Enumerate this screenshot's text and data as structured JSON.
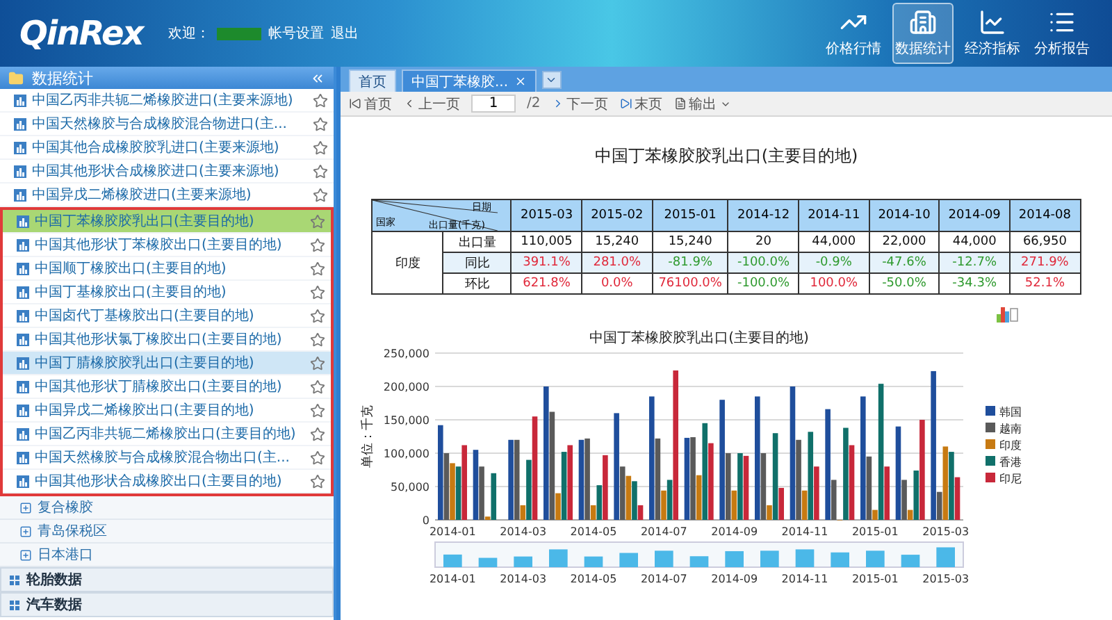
{
  "header": {
    "logo": "QinRex",
    "welcome": "欢迎：",
    "account_link": "帐号设置",
    "logout": "退出",
    "nav": [
      {
        "label": "价格行情",
        "selected": false,
        "kind": "trend"
      },
      {
        "label": "数据统计",
        "selected": true,
        "kind": "building"
      },
      {
        "label": "经济指标",
        "selected": false,
        "kind": "indicator"
      },
      {
        "label": "分析报告",
        "selected": false,
        "kind": "list"
      }
    ]
  },
  "sidebar": {
    "title": "数据统计",
    "groups": [
      {
        "outlined": false,
        "items": [
          {
            "label": "中国乙丙非共轭二烯橡胶进口(主要来源地)",
            "selected": false,
            "highlighted": false
          },
          {
            "label": "中国天然橡胶与合成橡胶混合物进口(主...",
            "selected": false,
            "highlighted": false
          },
          {
            "label": "中国其他合成橡胶胶乳进口(主要来源地)",
            "selected": false,
            "highlighted": false
          },
          {
            "label": "中国其他形状合成橡胶进口(主要来源地)",
            "selected": false,
            "highlighted": false
          },
          {
            "label": "中国异戊二烯橡胶进口(主要来源地)",
            "selected": false,
            "highlighted": false
          }
        ]
      },
      {
        "outlined": true,
        "items": [
          {
            "label": "中国丁苯橡胶胶乳出口(主要目的地)",
            "selected": true,
            "highlighted": false
          },
          {
            "label": "中国其他形状丁苯橡胶出口(主要目的地)",
            "selected": false,
            "highlighted": false
          },
          {
            "label": "中国顺丁橡胶出口(主要目的地)",
            "selected": false,
            "highlighted": false
          },
          {
            "label": "中国丁基橡胶出口(主要目的地)",
            "selected": false,
            "highlighted": false
          },
          {
            "label": "中国卤代丁基橡胶出口(主要目的地)",
            "selected": false,
            "highlighted": false
          },
          {
            "label": "中国其他形状氯丁橡胶出口(主要目的地)",
            "selected": false,
            "highlighted": false
          },
          {
            "label": "中国丁腈橡胶胶乳出口(主要目的地)",
            "selected": false,
            "highlighted": true
          },
          {
            "label": "中国其他形状丁腈橡胶出口(主要目的地)",
            "selected": false,
            "highlighted": false
          },
          {
            "label": "中国异戊二烯橡胶出口(主要目的地)",
            "selected": false,
            "highlighted": false
          },
          {
            "label": "中国乙丙非共轭二烯橡胶出口(主要目的地)",
            "selected": false,
            "highlighted": false
          },
          {
            "label": "中国天然橡胶与合成橡胶混合物出口(主...",
            "selected": false,
            "highlighted": false
          },
          {
            "label": "中国其他形状合成橡胶出口(主要目的地)",
            "selected": false,
            "highlighted": false
          }
        ]
      }
    ],
    "subgroups": [
      {
        "label": "复合橡胶",
        "expanded": false
      },
      {
        "label": "青岛保税区",
        "expanded": false
      },
      {
        "label": "日本港口",
        "expanded": false
      }
    ],
    "sections": [
      "轮胎数据",
      "汽车数据"
    ]
  },
  "tabs": [
    {
      "label": "首页",
      "selected": false,
      "closable": false
    },
    {
      "label": "中国丁苯橡胶...",
      "selected": true,
      "closable": true
    }
  ],
  "toolbar": {
    "first": "首页",
    "prev": "上一页",
    "page": "1",
    "total": "/2",
    "next": "下一页",
    "last": "末页",
    "export": "输出"
  },
  "report": {
    "title": "中国丁苯橡胶胶乳出口(主要目的地)",
    "table": {
      "corner": {
        "top": "日期",
        "middle": "出口量(千克)",
        "bottom": "国家"
      },
      "columns": [
        "2015-03",
        "2015-02",
        "2015-01",
        "2014-12",
        "2014-11",
        "2014-10",
        "2014-09",
        "2014-08"
      ],
      "country": "印度",
      "rows": [
        {
          "label": "出口量",
          "cells": [
            {
              "text": "110,005",
              "kind": "plain"
            },
            {
              "text": "15,240",
              "kind": "plain"
            },
            {
              "text": "15,240",
              "kind": "plain"
            },
            {
              "text": "20",
              "kind": "plain"
            },
            {
              "text": "44,000",
              "kind": "plain"
            },
            {
              "text": "22,000",
              "kind": "plain"
            },
            {
              "text": "44,000",
              "kind": "plain"
            },
            {
              "text": "66,950",
              "kind": "plain"
            }
          ]
        },
        {
          "label": "同比",
          "cells": [
            {
              "text": "391.1%",
              "kind": "up"
            },
            {
              "text": "281.0%",
              "kind": "up"
            },
            {
              "text": "-81.9%",
              "kind": "down"
            },
            {
              "text": "-100.0%",
              "kind": "down"
            },
            {
              "text": "-0.9%",
              "kind": "down"
            },
            {
              "text": "-47.6%",
              "kind": "down"
            },
            {
              "text": "-12.7%",
              "kind": "down"
            },
            {
              "text": "271.9%",
              "kind": "up"
            }
          ]
        },
        {
          "label": "环比",
          "cells": [
            {
              "text": "621.8%",
              "kind": "up"
            },
            {
              "text": "0.0%",
              "kind": "up"
            },
            {
              "text": "76100.0%",
              "kind": "up"
            },
            {
              "text": "-100.0%",
              "kind": "down"
            },
            {
              "text": "100.0%",
              "kind": "up"
            },
            {
              "text": "-50.0%",
              "kind": "down"
            },
            {
              "text": "-34.3%",
              "kind": "down"
            },
            {
              "text": "52.1%",
              "kind": "up"
            }
          ]
        }
      ]
    },
    "chart_data": {
      "type": "bar",
      "title": "中国丁苯橡胶胶乳出口(主要目的地)",
      "ylabel": "单位：千克",
      "categories": [
        "2014-01",
        null,
        "2014-03",
        null,
        "2014-05",
        null,
        "2014-07",
        null,
        "2014-09",
        null,
        "2014-11",
        null,
        "2015-01",
        null,
        "2015-03"
      ],
      "grid": true,
      "legend": "right",
      "ylim": [
        0,
        250000
      ],
      "yticks": [
        {
          "value": 0,
          "label": "0"
        },
        {
          "value": 50000,
          "label": "50,000"
        },
        {
          "value": 100000,
          "label": "100,000"
        },
        {
          "value": 150000,
          "label": "150,000"
        },
        {
          "value": 200000,
          "label": "200,000"
        },
        {
          "value": 250000,
          "label": "250,000"
        }
      ],
      "series": [
        {
          "name": "韩国",
          "color": "#1f4e9c",
          "values": [
            142000,
            105000,
            120000,
            200000,
            120000,
            160000,
            185000,
            123000,
            180000,
            185000,
            200000,
            166000,
            185000,
            140000,
            223000
          ]
        },
        {
          "name": "越南",
          "color": "#5a5a5a",
          "values": [
            100000,
            80000,
            120000,
            162000,
            122000,
            80000,
            122000,
            124000,
            100000,
            100000,
            120000,
            60000,
            95000,
            60000,
            42000
          ]
        },
        {
          "name": "印度",
          "color": "#c77a12",
          "values": [
            85000,
            5000,
            22000,
            40000,
            22000,
            66000,
            44000,
            67000,
            44000,
            22000,
            44000,
            0,
            15000,
            15000,
            110000
          ]
        },
        {
          "name": "香港",
          "color": "#10706a",
          "values": [
            80000,
            70000,
            90000,
            102000,
            52000,
            58000,
            60000,
            145000,
            100000,
            130000,
            132000,
            138000,
            204000,
            74000,
            102000
          ]
        },
        {
          "name": "印尼",
          "color": "#c8283a",
          "values": [
            112000,
            null,
            155000,
            112000,
            97000,
            22000,
            224000,
            115000,
            96000,
            48000,
            80000,
            112000,
            80000,
            150000,
            64000
          ]
        }
      ]
    },
    "navigator_labels": [
      "2014-01",
      "2014-03",
      "2014-05",
      "2014-07",
      "2014-09",
      "2014-11",
      "2015-01",
      "2015-03"
    ]
  }
}
